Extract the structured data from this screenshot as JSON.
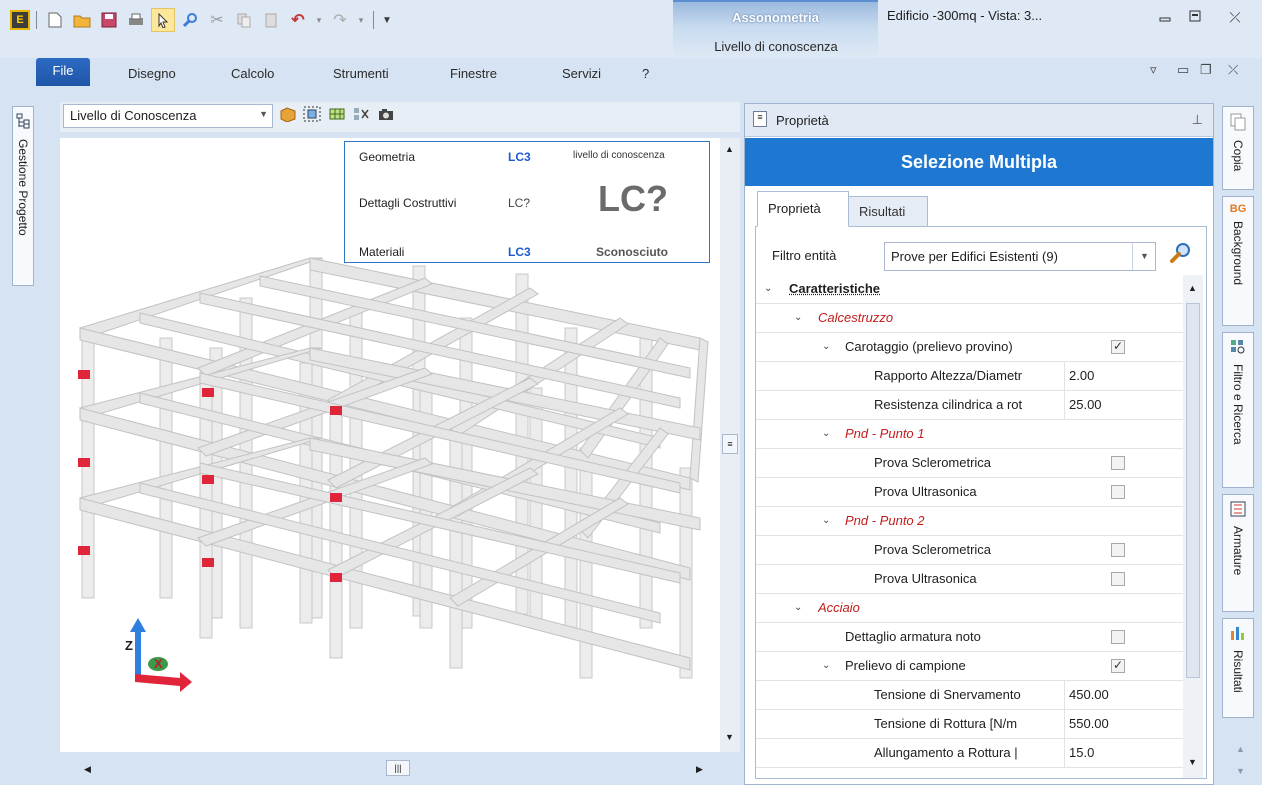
{
  "titlebar": {
    "app_icon": "E",
    "context_tab_group": "Assonometria",
    "context_tab": "Livello di conoscenza",
    "document_title": "Edificio -300mq - Vista: 3..."
  },
  "ribbon": {
    "file_tab": "File",
    "tabs": [
      "Disegno",
      "Calcolo",
      "Strumenti",
      "Finestre",
      "Servizi",
      "?"
    ]
  },
  "left_panel": {
    "tab_label": "Gestione Progetto"
  },
  "viewport": {
    "level_combo": "Livello di Conoscenza",
    "lc_table": {
      "rows": [
        {
          "label": "Geometria",
          "value": "LC3"
        },
        {
          "label": "Dettagli Costruttivi",
          "value": "LC?"
        },
        {
          "label": "Materiali",
          "value": "LC3"
        }
      ],
      "small_caption": "livello di conoscenza",
      "big_value": "LC?",
      "status": "Sconosciuto"
    },
    "axis_labels": {
      "z": "Z",
      "x": "X"
    }
  },
  "properties": {
    "panel_title": "Proprietà",
    "banner": "Selezione Multipla",
    "tabs": [
      "Proprietà",
      "Risultati"
    ],
    "filter_label": "Filtro entità",
    "filter_value": "Prove per Edifici Esistenti (9)",
    "rows": [
      {
        "name": "Caratteristiche",
        "kind": "category"
      },
      {
        "name": "Calcestruzzo",
        "kind": "subcategory"
      },
      {
        "name": "Carotaggio (prelievo provino)",
        "kind": "group",
        "checked": true
      },
      {
        "name": "Rapporto Altezza/Diametr",
        "kind": "value",
        "value": "2.00"
      },
      {
        "name": "Resistenza cilindrica a rot",
        "kind": "value",
        "value": "25.00"
      },
      {
        "name": "Pnd - Punto 1",
        "kind": "subcategory2"
      },
      {
        "name": "Prova Sclerometrica",
        "kind": "check",
        "checked": false
      },
      {
        "name": "Prova Ultrasonica",
        "kind": "check",
        "checked": false
      },
      {
        "name": "Pnd - Punto 2",
        "kind": "subcategory2"
      },
      {
        "name": "Prova Sclerometrica",
        "kind": "check",
        "checked": false
      },
      {
        "name": "Prova Ultrasonica",
        "kind": "check",
        "checked": false
      },
      {
        "name": "Acciaio",
        "kind": "subcategory"
      },
      {
        "name": "Dettaglio armatura noto",
        "kind": "check1",
        "checked": false
      },
      {
        "name": "Prelievo di campione",
        "kind": "group",
        "checked": true
      },
      {
        "name": "Tensione di Snervamento",
        "kind": "value",
        "value": "450.00"
      },
      {
        "name": "Tensione di Rottura  [N/m",
        "kind": "value",
        "value": "550.00"
      },
      {
        "name": "Allungamento a Rottura  |",
        "kind": "value",
        "value": "15.0"
      }
    ]
  },
  "right_panel": {
    "tabs": [
      "Copia",
      "Background",
      "Filtro e Ricerca",
      "Armature",
      "Risultati"
    ],
    "bg_icon_text": "BG"
  },
  "colors": {
    "accent_blue": "#1e78d2",
    "lc_blue": "#1f5bd0",
    "subcategory_red": "#c21c1c",
    "file_tab": "#1f56a8"
  }
}
